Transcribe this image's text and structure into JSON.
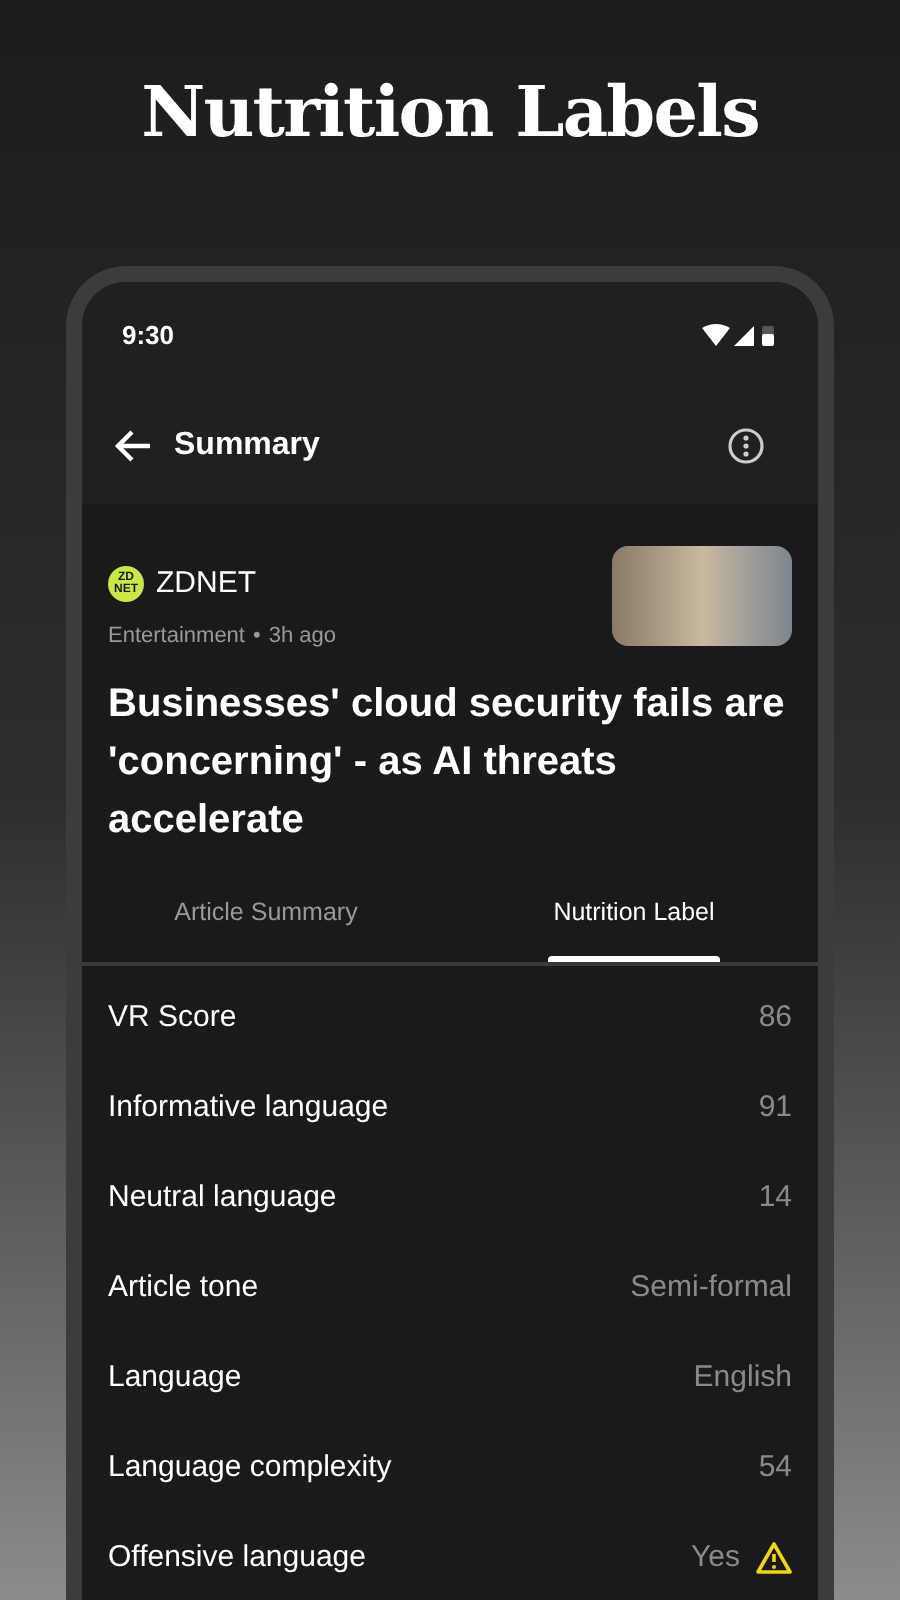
{
  "page_title": "Nutrition Labels",
  "status_bar": {
    "time": "9:30"
  },
  "app_bar": {
    "title": "Summary"
  },
  "article": {
    "source": "ZDNET",
    "logo_text": "ZD NET",
    "category": "Entertainment",
    "separator": "•",
    "age": "3h ago",
    "headline": "Businesses' cloud security fails are 'concerning' - as AI threats accelerate"
  },
  "tabs": [
    {
      "label": "Article Summary",
      "selected": false
    },
    {
      "label": "Nutrition Label",
      "selected": true
    }
  ],
  "metrics": [
    {
      "label": "VR Score",
      "value": "86",
      "warning": false
    },
    {
      "label": "Informative language",
      "value": "91",
      "warning": false
    },
    {
      "label": "Neutral language",
      "value": "14",
      "warning": false
    },
    {
      "label": "Article tone",
      "value": "Semi-formal",
      "warning": false
    },
    {
      "label": "Language",
      "value": "English",
      "warning": false
    },
    {
      "label": "Language complexity",
      "value": "54",
      "warning": false
    },
    {
      "label": "Offensive language",
      "value": "Yes",
      "warning": true
    }
  ]
}
